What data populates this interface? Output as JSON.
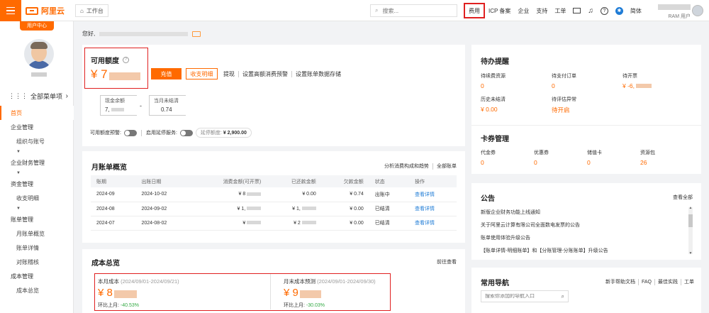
{
  "topbar": {
    "brand": "阿里云",
    "workbench": "工作台",
    "search_placeholder": "搜索...",
    "nav": [
      "费用",
      "ICP 备案",
      "企业",
      "支持",
      "工单"
    ],
    "lang": "简体",
    "account_role": "RAM 用户"
  },
  "sidebar": {
    "user_center": "用户中心",
    "all_menu": "全部菜单项",
    "items": [
      {
        "label": "首页",
        "type": "active"
      },
      {
        "label": "企业管理",
        "type": "group"
      },
      {
        "label": "组织与账号",
        "type": "sub"
      },
      {
        "label": "▼",
        "type": "caret"
      },
      {
        "label": "企业财务管理",
        "type": "group"
      },
      {
        "label": "▼",
        "type": "caret"
      },
      {
        "label": "资金管理",
        "type": "group"
      },
      {
        "label": "收支明细",
        "type": "sub"
      },
      {
        "label": "▼",
        "type": "caret"
      },
      {
        "label": "账单管理",
        "type": "group"
      },
      {
        "label": "月账单概览",
        "type": "sub"
      },
      {
        "label": "账单详情",
        "type": "sub"
      },
      {
        "label": "对账稽核",
        "type": "sub"
      },
      {
        "label": "成本管理",
        "type": "group"
      },
      {
        "label": "成本总览",
        "type": "sub"
      }
    ]
  },
  "greeting": "您好,",
  "credit": {
    "title": "可用额度",
    "amount_prefix": "¥ 7",
    "recharge": "充值",
    "payment_details": "收支明细",
    "links": [
      "提现",
      "设置高额消费预警",
      "设置账单数据存储"
    ],
    "cash_balance_label": "现金余额",
    "cash_balance_value": "7,",
    "minus": "-",
    "unsettled_label": "当月未结清",
    "unsettled_value": "0.74",
    "warning_label": "可用额度预警:",
    "overdue_label": "启用延停服务:",
    "overdue_chip_label": "延停额度:",
    "overdue_chip_value": "¥ 2,900.00"
  },
  "monthly": {
    "title": "月账单概览",
    "links": [
      "分析消费构成和趋势",
      "全部账单"
    ],
    "columns": [
      "账期",
      "出账日期",
      "消费金额(可开票)",
      "已还款金额",
      "欠款金额",
      "状态",
      "操作"
    ],
    "rows": [
      {
        "period": "2024-09",
        "date": "2024-10-02",
        "consume": "¥ 8",
        "repaid": "¥ 0.00",
        "owed": "¥ 0.74",
        "status": "出账中",
        "action": "查看详情"
      },
      {
        "period": "2024-08",
        "date": "2024-09-02",
        "consume": "¥ 1,",
        "repaid": "¥ 1,",
        "owed": "¥ 0.00",
        "status": "已结清",
        "action": "查看详情"
      },
      {
        "period": "2024-07",
        "date": "2024-08-02",
        "consume": "¥",
        "repaid": "¥ 2",
        "owed": "¥ 0.00",
        "status": "已结清",
        "action": "查看详情"
      }
    ]
  },
  "cost": {
    "title": "成本总览",
    "link": "前往查看",
    "current": {
      "label": "本月成本",
      "range": "(2024/09/01-2024/09/21)",
      "amount": "¥ 8",
      "mom_label": "环比上月:",
      "mom_value": "-40.53%"
    },
    "forecast": {
      "label": "月末成本预测",
      "range": "(2024/09/01-2024/09/30)",
      "amount": "¥ 9",
      "mom_label": "环比上月:",
      "mom_value": "-30.03%"
    }
  },
  "todo": {
    "title": "待办提醒",
    "items": [
      {
        "label": "待续费资源",
        "value": "0"
      },
      {
        "label": "待支付订单",
        "value": "0"
      },
      {
        "label": "待开票",
        "value": "¥ -6,"
      },
      {
        "label": "历史未结清",
        "value": "¥ 0.00"
      },
      {
        "label": "待评估异常",
        "value": "待开启"
      }
    ],
    "voucher_title": "卡券管理",
    "vouchers": [
      {
        "label": "代金券",
        "value": "0"
      },
      {
        "label": "优惠券",
        "value": "0"
      },
      {
        "label": "储值卡",
        "value": "0"
      },
      {
        "label": "资源包",
        "value": "26"
      }
    ]
  },
  "notice": {
    "title": "公告",
    "view_all": "查看全部",
    "items": [
      "新版企业财务功能上线通知",
      "关于阿里云计算有限公司全面数电发票的公告",
      "账单使用体验升级公告",
      "【账单详情-明细账单】和【分账管理-分账账单】升级公告"
    ]
  },
  "quicknav": {
    "title": "常用导航",
    "links": [
      "新手帮助文档",
      "FAQ",
      "最佳实践",
      "工单"
    ],
    "search_placeholder": "搜索你添加的导航入口"
  },
  "colors": {
    "accent": "#ff6a00",
    "highlight": "#e02020",
    "link": "#1f7cd6",
    "positive": "#33aa44"
  }
}
